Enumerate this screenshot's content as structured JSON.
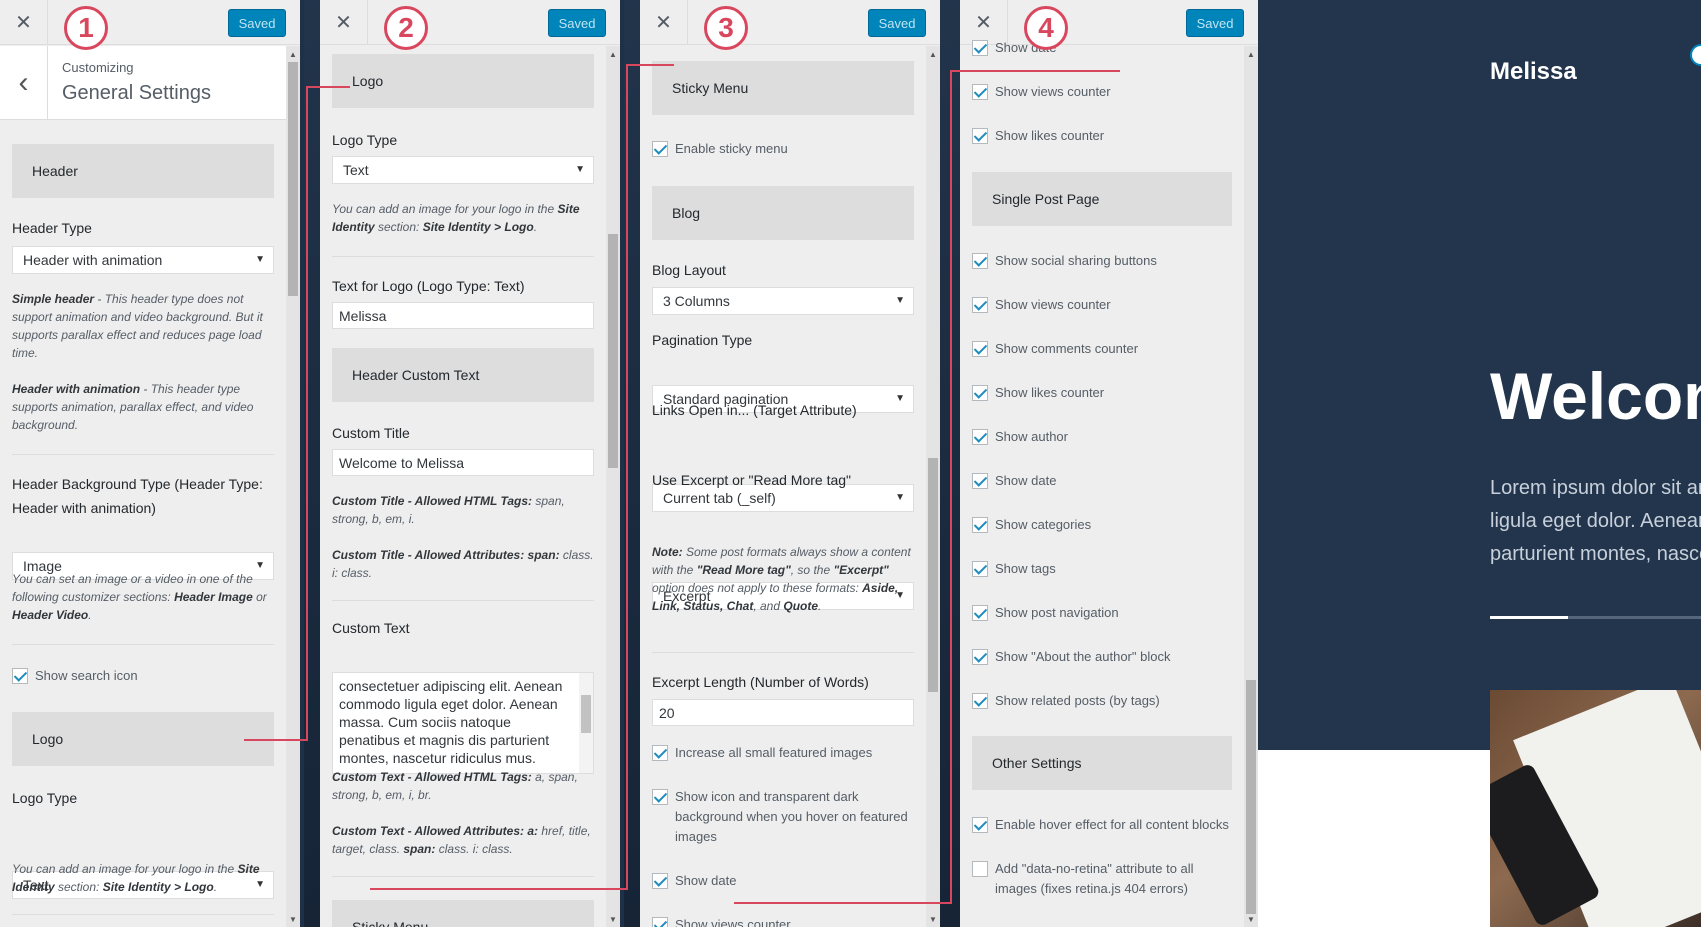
{
  "common": {
    "close_icon": "✕",
    "saved_label": "Saved"
  },
  "badges": [
    "1",
    "2",
    "3",
    "4"
  ],
  "panel1": {
    "breadcrumb_small": "Customizing",
    "breadcrumb_title": "General Settings",
    "back_icon": "‹",
    "header_section": "Header",
    "header_type_label": "Header Type",
    "header_type_value": "Header with animation",
    "simple_header_bold": "Simple header",
    "simple_header_text": " - This header type does not support animation and video background. But it supports parallax effect and reduces page load time.",
    "anim_header_bold": "Header with animation",
    "anim_header_text": " - This header type supports animation, parallax effect, and video background.",
    "bg_type_label": "Header Background Type (Header Type: Header with animation)",
    "bg_type_value": "Image",
    "bg_desc_1": "You can set an image or a video in one of the following customizer sections: ",
    "bg_desc_b1": "Header Image",
    "bg_desc_2": " or ",
    "bg_desc_b2": "Header Video",
    "bg_desc_3": ".",
    "show_search_icon": "Show search icon",
    "logo_section": "Logo",
    "logo_type_label": "Logo Type",
    "logo_type_value": "Text",
    "logo_desc_1": "You can add an image for your logo in the ",
    "logo_desc_b1": "Site Identity",
    "logo_desc_2": " section: ",
    "logo_desc_b2": "Site Identity > Logo",
    "logo_desc_3": "."
  },
  "panel2": {
    "logo_section": "Logo",
    "logo_type_label": "Logo Type",
    "logo_type_value": "Text",
    "logo_desc_1": "You can add an image for your logo in the ",
    "logo_desc_b1": "Site Identity",
    "logo_desc_2": " section: ",
    "logo_desc_b2": "Site Identity > Logo",
    "logo_desc_3": ".",
    "text_logo_label": "Text for Logo (Logo Type: Text)",
    "text_logo_value": "Melissa",
    "header_custom_section": "Header Custom Text",
    "custom_title_label": "Custom Title",
    "custom_title_value": "Welcome to Melissa",
    "ct_tags_b": "Custom Title - Allowed HTML Tags:",
    "ct_tags_t": " span, strong, b, em, i.",
    "ct_attr_b": "Custom Title - Allowed Attributes: span:",
    "ct_attr_t": " class. i: class.",
    "custom_text_label": "Custom Text",
    "custom_text_value": "consectetuer adipiscing elit. Aenean commodo ligula eget dolor. Aenean massa. Cum sociis natoque penatibus et magnis dis parturient montes, nascetur ridiculus mus.",
    "cx_tags_b": "Custom Text - Allowed HTML Tags:",
    "cx_tags_t": " a, span, strong, b, em, i, br.",
    "cx_attr_b": "Custom Text - Allowed Attributes: a:",
    "cx_attr_t": " href, title, target, class. ",
    "cx_attr_b2": "span:",
    "cx_attr_t2": " class. i: class.",
    "sticky_section": "Sticky Menu"
  },
  "panel3": {
    "sticky_section": "Sticky Menu",
    "enable_sticky": "Enable sticky menu",
    "blog_section": "Blog",
    "blog_layout_label": "Blog Layout",
    "blog_layout_value": "3 Columns",
    "pagination_label": "Pagination Type",
    "pagination_value": "Standard pagination",
    "links_label": "Links Open in... (Target Attribute)",
    "links_value": "Current tab (_self)",
    "excerpt_label": "Use Excerpt or \"Read More tag\"",
    "excerpt_value": "Excerpt",
    "note_b": "Note:",
    "note_1": " Some post formats always show a content with the ",
    "note_b2": "\"Read More tag\"",
    "note_2": ", so the ",
    "note_b3": "\"Excerpt\"",
    "note_3": " option does not apply to these formats: ",
    "note_b4": "Aside, Link, Status, Chat",
    "note_4": ", and ",
    "note_b5": "Quote",
    "note_5": ".",
    "excerpt_len_label": "Excerpt Length (Number of Words)",
    "excerpt_len_value": "20",
    "increase_images": "Increase all small featured images",
    "show_icon_hover": "Show icon and transparent dark background when you hover on featured images",
    "show_date": "Show date",
    "show_views": "Show views counter"
  },
  "panel4": {
    "show_date_top": "Show date",
    "show_views": "Show views counter",
    "show_likes": "Show likes counter",
    "single_section": "Single Post Page",
    "items": [
      "Show social sharing buttons",
      "Show views counter",
      "Show comments counter",
      "Show likes counter",
      "Show author",
      "Show date",
      "Show categories",
      "Show tags",
      "Show post navigation",
      "Show \"About the author\" block",
      "Show related posts (by tags)"
    ],
    "other_section": "Other Settings",
    "hover_effect": "Enable hover effect for all content blocks",
    "no_retina": "Add \"data-no-retina\" attribute to all images (fixes retina.js 404 errors)"
  },
  "preview": {
    "site_title": "Melissa",
    "hero_title": "Welcome to Melissa",
    "hero_line1": "Lorem ipsum dolor sit amet, consectetuer",
    "hero_line2": "ligula eget dolor. Aenean massa. Cum",
    "hero_line3": "parturient montes, nascetur ridiculus mus."
  },
  "colors": {
    "accent": "#0085ba",
    "connector": "#d9475f",
    "panel_bg": "#eeeeee",
    "section_bg": "#dddddd"
  }
}
